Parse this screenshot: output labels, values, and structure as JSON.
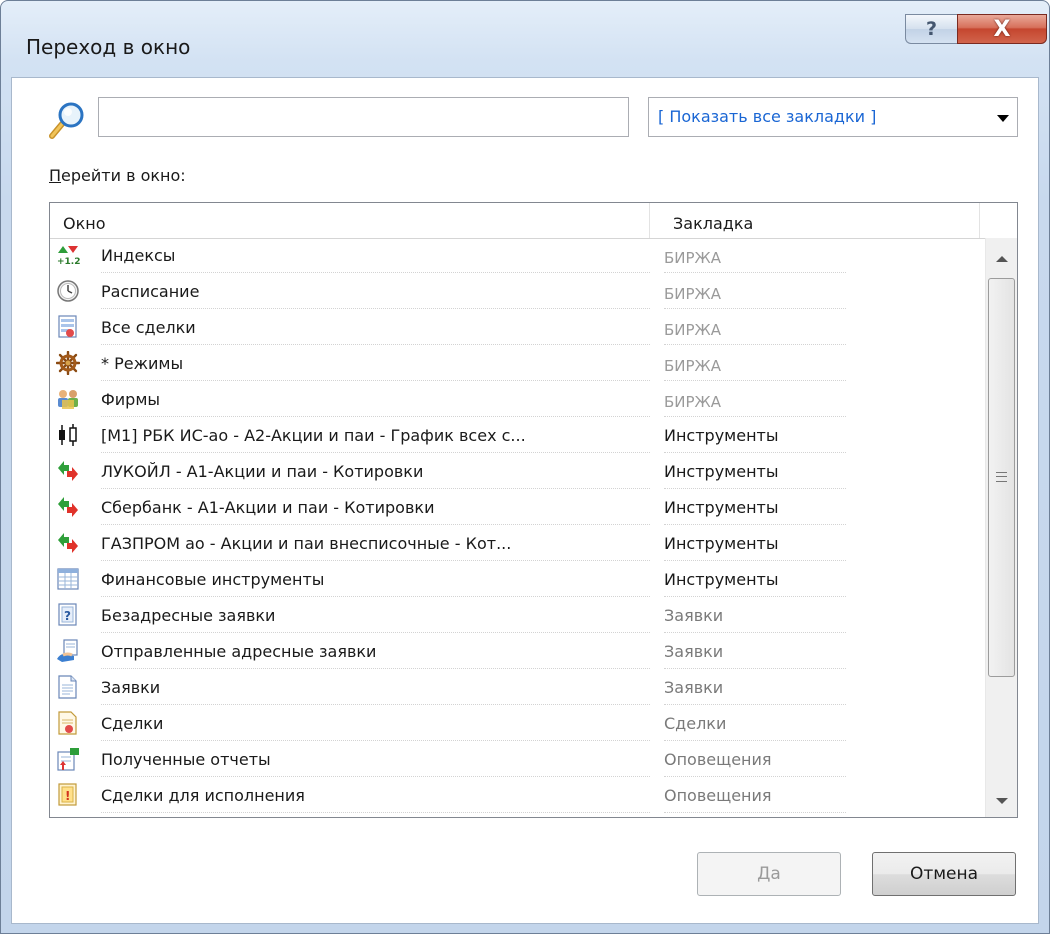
{
  "window": {
    "title": "Переход в окно",
    "help_label": "?",
    "close_label": "X"
  },
  "search": {
    "value": "",
    "placeholder": ""
  },
  "bookmark_filter": {
    "selected": "[ Показать все закладки ]"
  },
  "goto_label": {
    "accel": "П",
    "rest": "ерейти в окно:"
  },
  "list": {
    "columns": [
      "Окно",
      "Закладка"
    ],
    "rows": [
      {
        "icon": "indexes-icon",
        "window": "Индексы",
        "bookmark": "БИРЖА"
      },
      {
        "icon": "clock-icon",
        "window": "Расписание",
        "bookmark": "БИРЖА"
      },
      {
        "icon": "all-trades-icon",
        "window": "Все сделки",
        "bookmark": "БИРЖА"
      },
      {
        "icon": "ship-wheel-icon",
        "window": "* Режимы",
        "bookmark": "БИРЖА"
      },
      {
        "icon": "firms-icon",
        "window": "Фирмы",
        "bookmark": "БИРЖА"
      },
      {
        "icon": "candlestick-icon",
        "window": "[M1] РБК ИС-ао - А2-Акции и паи - График всех с...",
        "bookmark": "Инструменты"
      },
      {
        "icon": "quotes-icon",
        "window": "ЛУКОЙЛ - А1-Акции и паи - Котировки",
        "bookmark": "Инструменты"
      },
      {
        "icon": "quotes-icon",
        "window": "Сбербанк - А1-Акции и паи - Котировки",
        "bookmark": "Инструменты"
      },
      {
        "icon": "quotes-icon",
        "window": "ГАЗПРОМ ао - Акции и паи внесписочные - Кот...",
        "bookmark": "Инструменты"
      },
      {
        "icon": "table-icon",
        "window": "Финансовые инструменты",
        "bookmark": "Инструменты"
      },
      {
        "icon": "question-doc-icon",
        "window": "Безадресные заявки",
        "bookmark": "Заявки"
      },
      {
        "icon": "hand-doc-icon",
        "window": "Отправленные адресные заявки",
        "bookmark": "Заявки"
      },
      {
        "icon": "document-icon",
        "window": "Заявки",
        "bookmark": "Заявки"
      },
      {
        "icon": "deals-doc-icon",
        "window": "Сделки",
        "bookmark": "Сделки"
      },
      {
        "icon": "received-reports-icon",
        "window": "Полученные отчеты",
        "bookmark": "Оповещения"
      },
      {
        "icon": "alert-doc-icon",
        "window": "Сделки для исполнения",
        "bookmark": "Оповещения"
      }
    ]
  },
  "buttons": {
    "ok": "Да",
    "cancel": "Отмена"
  },
  "colors": {
    "frame": "#c3d5eb",
    "close": "#c5462f",
    "link_blue": "#1a66d4",
    "exchange_gray": "#9a9a9a"
  }
}
